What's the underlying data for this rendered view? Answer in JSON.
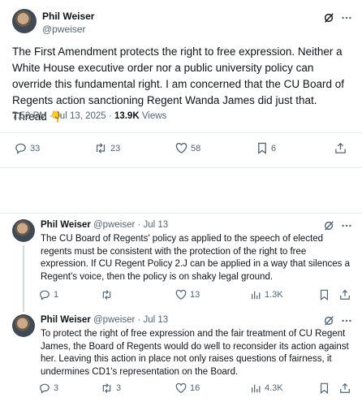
{
  "main": {
    "name": "Phil Weiser",
    "handle": "@pweiser",
    "text": "The First Amendment protects the right to free expression. Neither a White House executive order nor a public university policy can override this fundamental right. I am concerned that the CU Board of Regents action sanctioning Regent Wanda James did just that. Thread 👇",
    "time": "7:52 PM · Jul 13, 2025 · ",
    "views_count": "13.9K",
    "views_label": " Views",
    "replies": "33",
    "reposts": "23",
    "likes": "58",
    "bookmarks": "6"
  },
  "replies": [
    {
      "name": "Phil Weiser",
      "handle": "@pweiser · Jul 13",
      "text": "The CU Board of Regents' policy as applied to the speech of elected regents must be consistent with the protection of the right to free expression. If CU Regent Policy 2.J can be applied in a way that silences a Regent's voice, then the policy is on shaky legal ground.",
      "replies": "1",
      "reposts": "",
      "likes": "13",
      "views": "1.3K"
    },
    {
      "name": "Phil Weiser",
      "handle": "@pweiser · Jul 13",
      "text": "To protect the right of free expression and the fair treatment of CU Regent James, the Board of Regents would do well to reconsider its action against her. Leaving this action in place not only raises questions of fairness, it undermines CD1's representation on the Board.",
      "replies": "3",
      "reposts": "3",
      "likes": "16",
      "views": "4.3K"
    }
  ],
  "icons": {
    "reply": "reply-icon",
    "repost": "repost-icon",
    "like": "heart-icon",
    "bookmark": "bookmark-icon",
    "share": "share-icon",
    "views": "views-icon",
    "grok": "grok-icon",
    "more": "more-icon"
  }
}
